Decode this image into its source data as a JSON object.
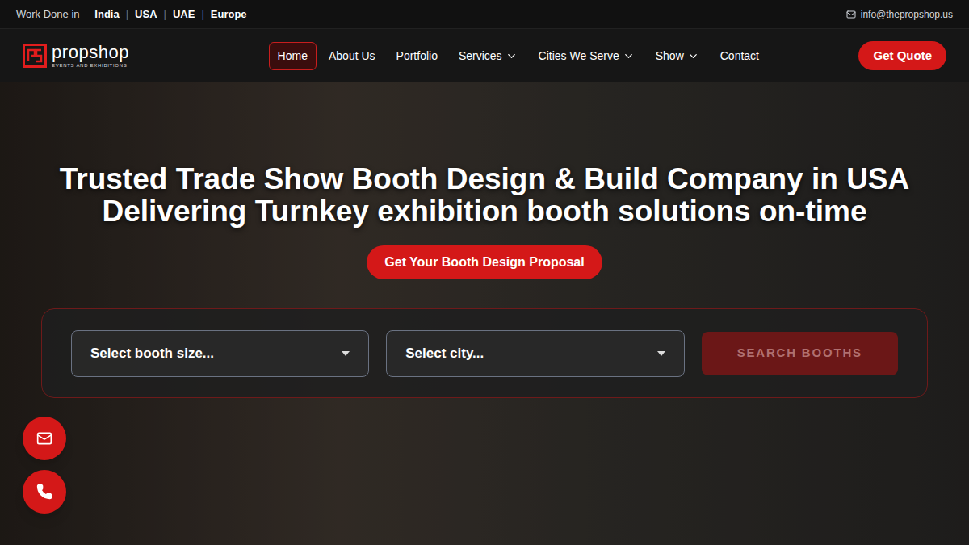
{
  "top_bar": {
    "prefix": "Work Done in –",
    "regions": [
      "India",
      "USA",
      "UAE",
      "Europe"
    ],
    "separator": "|",
    "email": "info@thepropshop.us"
  },
  "logo": {
    "name": "propshop",
    "tagline": "EVENTS AND EXHIBITIONS"
  },
  "nav": {
    "items": [
      {
        "label": "Home",
        "selected": true,
        "dropdown": false
      },
      {
        "label": "About Us",
        "selected": false,
        "dropdown": false
      },
      {
        "label": "Portfolio",
        "selected": false,
        "dropdown": false
      },
      {
        "label": "Services",
        "selected": false,
        "dropdown": true
      },
      {
        "label": "Cities We Serve",
        "selected": false,
        "dropdown": true
      },
      {
        "label": "Show",
        "selected": false,
        "dropdown": true
      },
      {
        "label": "Contact",
        "selected": false,
        "dropdown": false
      }
    ]
  },
  "cta": "Get Quote",
  "hero": {
    "headline": "Trusted Trade Show Booth Design & Build Company in USA Delivering Turnkey exhibition booth solutions on-time",
    "button": "Get Your Booth Design Proposal"
  },
  "search": {
    "fields": [
      {
        "placeholder": "Select booth size..."
      },
      {
        "placeholder": "Select city..."
      }
    ],
    "button": {
      "label": "SEARCH BOOTHS",
      "disabled": true
    }
  }
}
